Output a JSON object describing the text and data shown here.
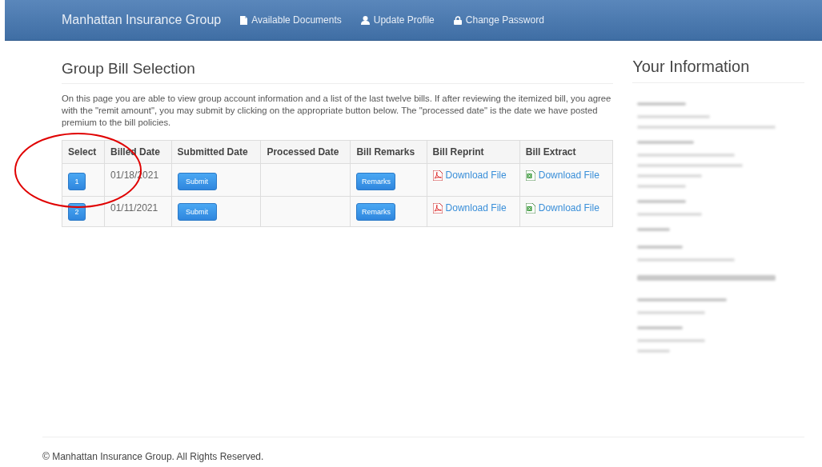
{
  "navbar": {
    "brand": "Manhattan Insurance Group",
    "links": [
      {
        "label": "Available Documents"
      },
      {
        "label": "Update Profile"
      },
      {
        "label": "Change Password"
      }
    ]
  },
  "main": {
    "title": "Group Bill Selection",
    "intro": "On this page you are able to view group account information and a list of the last twelve bills. If after reviewing the itemized bill, you agree with the \"remit amount\", you may submit by clicking on the appropriate button below. The \"processed date\" is the date we have posted premium to the bill policies.",
    "table": {
      "columns": [
        "Select",
        "Billed Date",
        "Submitted Date",
        "Processed Date",
        "Bill Remarks",
        "Bill Reprint",
        "Bill Extract"
      ],
      "rows": [
        {
          "select": "1",
          "billed_date": "01/18/2021",
          "submit": "Submit",
          "processed_date": "",
          "remarks": "Remarks",
          "reprint": "Download File",
          "extract": "Download File"
        },
        {
          "select": "2",
          "billed_date": "01/11/2021",
          "submit": "Submit",
          "processed_date": "",
          "remarks": "Remarks",
          "reprint": "Download File",
          "extract": "Download File"
        }
      ]
    }
  },
  "sidebar": {
    "title": "Your Information",
    "blurred_lines": [
      {
        "kind": "label"
      },
      {
        "kind": "value"
      },
      {
        "kind": "value"
      },
      {
        "kind": "label"
      },
      {
        "kind": "value"
      },
      {
        "kind": "value"
      },
      {
        "kind": "value"
      },
      {
        "kind": "value"
      },
      {
        "kind": "label"
      },
      {
        "kind": "value"
      },
      {
        "kind": "label"
      },
      {
        "kind": "label"
      },
      {
        "kind": "value"
      },
      {
        "kind": "heading"
      },
      {
        "kind": "label"
      },
      {
        "kind": "value"
      },
      {
        "kind": "label"
      },
      {
        "kind": "value"
      },
      {
        "kind": "value"
      }
    ]
  },
  "footer": {
    "text": "© Manhattan Insurance Group. All Rights Reserved."
  },
  "annotation": {
    "kind": "circle"
  }
}
